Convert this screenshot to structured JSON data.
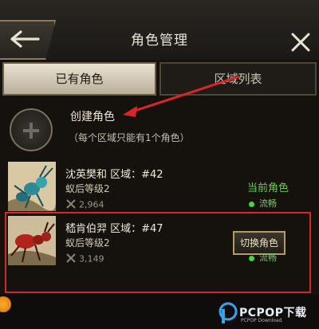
{
  "header": {
    "title": "角色管理",
    "back_icon": "arrow-left-icon",
    "close_icon": "close-icon"
  },
  "tabs": {
    "owned": "已有角色",
    "region_list": "区域列表"
  },
  "create": {
    "label": "创建角色",
    "note": "（每个区域只能有1个角色）"
  },
  "roles": [
    {
      "name": "沈英樊和  区域：#42",
      "level": "蚁后等级2",
      "power": "2,964",
      "tag": "当前角色",
      "status": "流畅"
    },
    {
      "name": "嵇肯伯羿  区域：#47",
      "level": "蚁后等级2",
      "power": "3,149",
      "button": "切换角色",
      "status": "流畅"
    }
  ],
  "watermark": {
    "text": "PCPOP下载",
    "sub": "PCPOP Download"
  },
  "colors": {
    "annotation_red": "#d9262a",
    "status_green": "#42d644"
  }
}
